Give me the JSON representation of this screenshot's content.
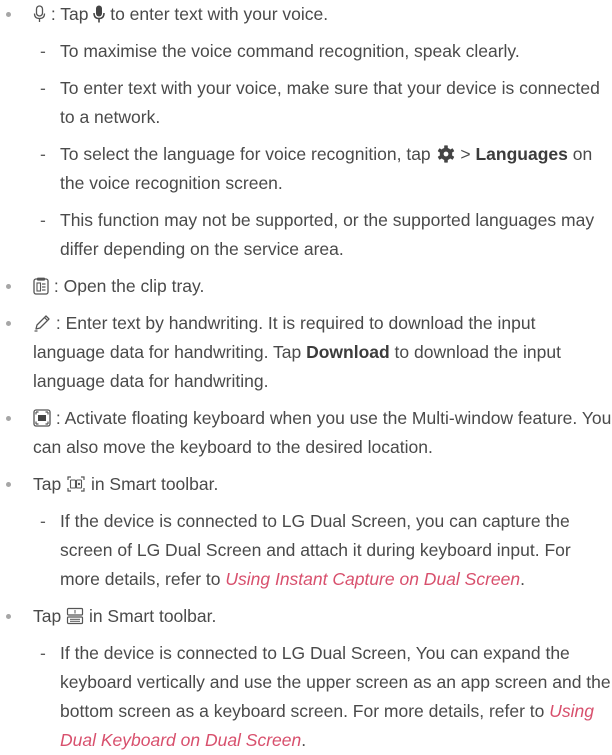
{
  "items": {
    "mic": {
      "sep": " : ",
      "text_a": "Tap ",
      "text_b": " to enter text with your voice."
    },
    "mic_sub1": "To maximise the voice command recognition, speak clearly.",
    "mic_sub2": "To enter text with your voice, make sure that your device is connected to a network.",
    "mic_sub3": {
      "text_a": "To select the language for voice recognition, tap ",
      "gt": " > ",
      "bold": "Languages",
      "text_b": " on the voice recognition screen."
    },
    "mic_sub4": "This function may not be supported, or the supported languages may differ depending on the service area.",
    "clip": {
      "sep": " : ",
      "text": "Open the clip tray."
    },
    "pen": {
      "sep": " : ",
      "text_a": "Enter text by handwriting. It is required to download the input language data for handwriting. Tap ",
      "bold": "Download",
      "text_b": " to download the input language data for handwriting."
    },
    "float": {
      "sep": " : ",
      "text": "Activate floating keyboard when you use the Multi-window feature. You can also move the keyboard to the desired location."
    },
    "capture": {
      "text_a": "Tap ",
      "text_b": " in Smart toolbar.",
      "sub_a": "If the device is connected to LG Dual Screen, you can capture the screen of LG Dual Screen and attach it during keyboard input. For more details, refer to ",
      "link": "Using Instant Capture on Dual Screen",
      "sub_b": "."
    },
    "dualkb": {
      "text_a": "Tap ",
      "text_b": " in Smart toolbar.",
      "sub_a": "If the device is connected to LG Dual Screen, You can expand the keyboard vertically and use the upper screen as an app screen and the bottom screen as a keyboard screen. For more details, refer to ",
      "link": "Using Dual Keyboard on Dual Screen",
      "sub_b": "."
    }
  },
  "dash": "-",
  "icons": [
    "microphone-outline-icon",
    "microphone-filled-icon",
    "gear-icon",
    "clip-tray-icon",
    "pen-icon",
    "floating-keyboard-icon",
    "instant-capture-icon",
    "dual-keyboard-icon"
  ],
  "colors": {
    "text": "#4a4a4a",
    "link": "#d8506d",
    "bullet": "#a6a6a6"
  }
}
